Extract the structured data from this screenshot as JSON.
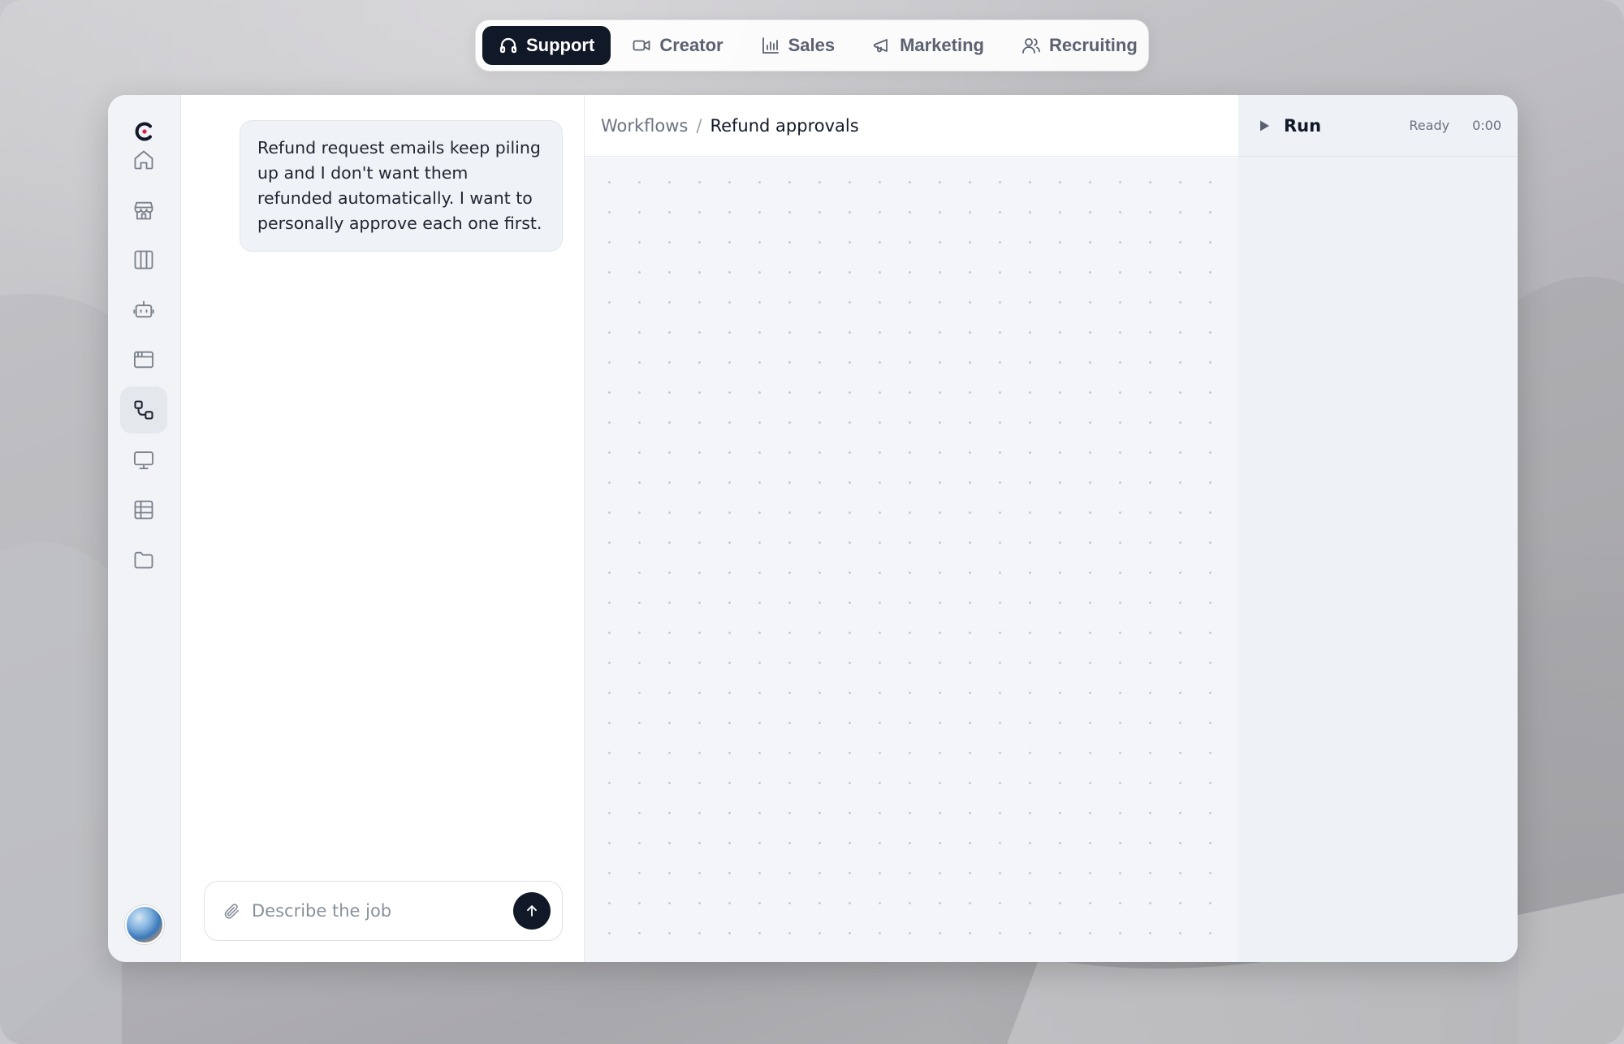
{
  "topnav": {
    "tabs": [
      {
        "label": "Support",
        "icon": "headphones-icon",
        "active": true
      },
      {
        "label": "Creator",
        "icon": "video-icon",
        "active": false
      },
      {
        "label": "Sales",
        "icon": "bar-chart-icon",
        "active": false
      },
      {
        "label": "Marketing",
        "icon": "megaphone-icon",
        "active": false
      },
      {
        "label": "Recruiting",
        "icon": "users-icon",
        "active": false
      }
    ]
  },
  "sidebar": {
    "items": [
      {
        "icon": "home-icon"
      },
      {
        "icon": "store-icon"
      },
      {
        "icon": "columns-icon"
      },
      {
        "icon": "bot-icon"
      },
      {
        "icon": "browser-window-icon"
      },
      {
        "icon": "workflow-icon",
        "active": true
      },
      {
        "icon": "monitor-icon"
      },
      {
        "icon": "table-icon"
      },
      {
        "icon": "folder-icon"
      }
    ]
  },
  "chat": {
    "message": "Refund request emails keep piling up and I don't want them refunded automatically. I want to personally approve each one first.",
    "composer_placeholder": "Describe the job",
    "composer_value": ""
  },
  "breadcrumb": {
    "root": "Workflows",
    "separator": "/",
    "current": "Refund approvals"
  },
  "run_panel": {
    "run_label": "Run",
    "status": "Ready",
    "elapsed": "0:00"
  },
  "colors": {
    "accent_dark": "#111827",
    "canvas_bg": "#f3f5f8",
    "rail_bg": "#f1f3f6",
    "logo_accent": "#e11d48"
  }
}
